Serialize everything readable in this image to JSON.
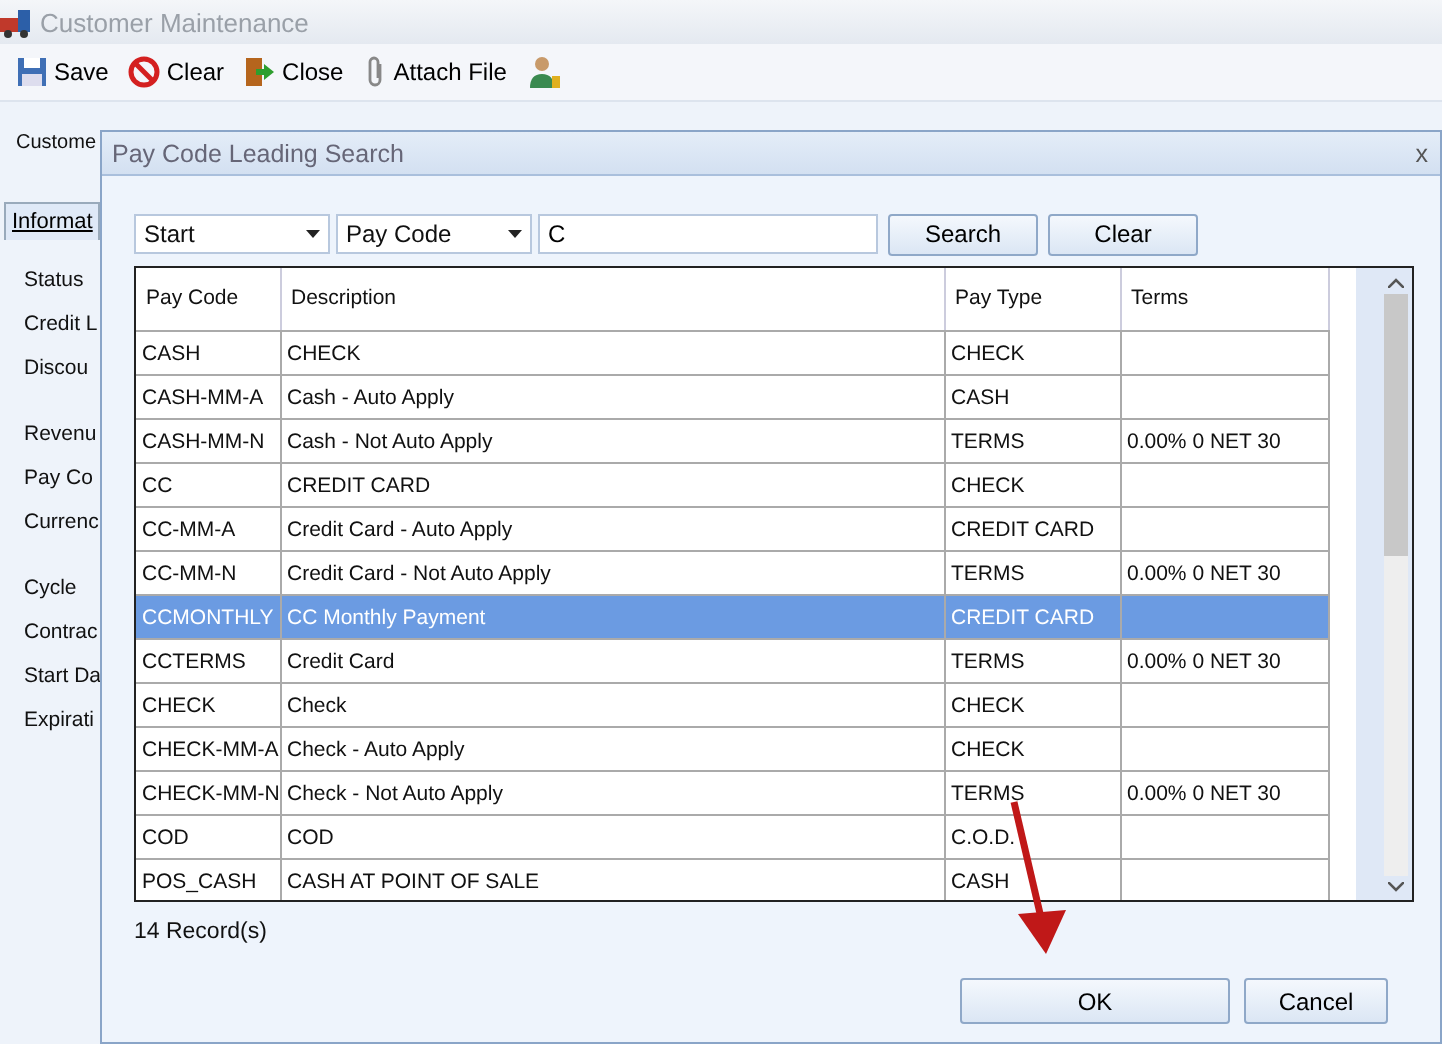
{
  "window": {
    "title": "Customer Maintenance"
  },
  "toolbar": [
    {
      "label": "Save",
      "kind": "save"
    },
    {
      "label": "Clear",
      "kind": "clear"
    },
    {
      "label": "Close",
      "kind": "close"
    },
    {
      "label": "Attach File",
      "kind": "attach"
    },
    {
      "kind": "user"
    }
  ],
  "customer_label": "Custome",
  "tab": {
    "label": "Informat",
    "selected": true
  },
  "field_groups": [
    [
      "Status",
      "Credit L",
      "Discou"
    ],
    [
      "Revenu",
      "Pay Co",
      "Currenc"
    ],
    [
      "Cycle",
      "Contrac",
      "Start Da",
      "Expirati"
    ]
  ],
  "dialog": {
    "title": "Pay Code Leading Search",
    "close": "x",
    "search": {
      "match": "Start",
      "field": "Pay Code",
      "value": "C",
      "search_button": "Search",
      "clear_button": "Clear"
    },
    "table": {
      "columns": [
        "Pay Code",
        "Description",
        "Pay Type",
        "Terms"
      ],
      "rows": [
        {
          "cells": [
            "CASH",
            "CHECK",
            "CHECK",
            ""
          ],
          "selected": false
        },
        {
          "cells": [
            "CASH-MM-A",
            "Cash - Auto Apply",
            "CASH",
            ""
          ],
          "selected": false
        },
        {
          "cells": [
            "CASH-MM-N",
            "Cash - Not Auto Apply",
            "TERMS",
            "0.00% 0 NET 30"
          ],
          "selected": false
        },
        {
          "cells": [
            "CC",
            "CREDIT CARD",
            "CHECK",
            ""
          ],
          "selected": false
        },
        {
          "cells": [
            "CC-MM-A",
            "Credit Card - Auto Apply",
            "CREDIT CARD",
            ""
          ],
          "selected": false
        },
        {
          "cells": [
            "CC-MM-N",
            "Credit Card - Not Auto Apply",
            "TERMS",
            "0.00% 0 NET 30"
          ],
          "selected": false
        },
        {
          "cells": [
            "CCMONTHLY",
            "CC Monthly Payment",
            "CREDIT CARD",
            ""
          ],
          "selected": true
        },
        {
          "cells": [
            "CCTERMS",
            "Credit Card",
            "TERMS",
            "0.00% 0 NET 30"
          ],
          "selected": false
        },
        {
          "cells": [
            "CHECK",
            "Check",
            "CHECK",
            ""
          ],
          "selected": false
        },
        {
          "cells": [
            "CHECK-MM-A",
            "Check - Auto Apply",
            "CHECK",
            ""
          ],
          "selected": false
        },
        {
          "cells": [
            "CHECK-MM-N",
            "Check - Not Auto Apply",
            "TERMS",
            "0.00% 0 NET 30"
          ],
          "selected": false
        },
        {
          "cells": [
            "COD",
            "COD",
            "C.O.D.",
            ""
          ],
          "selected": false
        },
        {
          "cells": [
            "POS_CASH",
            "CASH AT POINT OF SALE",
            "CASH",
            ""
          ],
          "selected": false
        }
      ]
    },
    "record_count": "14 Record(s)",
    "buttons": [
      "OK",
      "Cancel"
    ]
  }
}
